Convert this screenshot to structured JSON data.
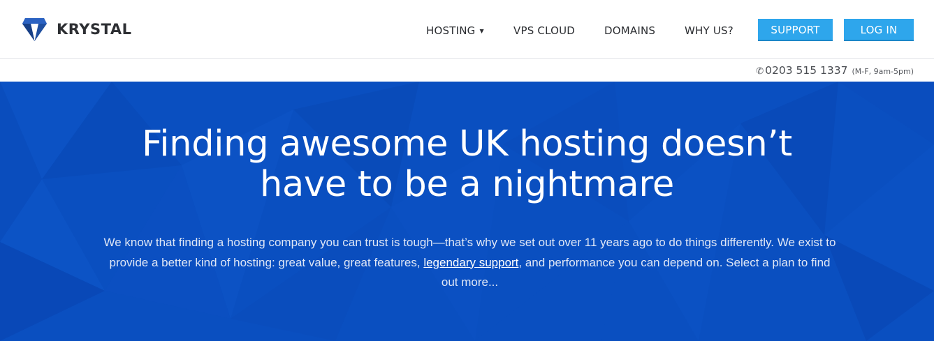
{
  "brand": {
    "name": "KRYSTAL"
  },
  "nav": {
    "items": [
      {
        "label": "HOSTING",
        "has_dropdown": true
      },
      {
        "label": "VPS CLOUD"
      },
      {
        "label": "DOMAINS"
      },
      {
        "label": "WHY US?"
      }
    ],
    "support_label": "SUPPORT",
    "login_label": "LOG IN"
  },
  "contact": {
    "icon": "phone-icon",
    "phone": "0203 515 1337",
    "hours": "(M-F, 9am-5pm)"
  },
  "hero": {
    "title_line1": "Finding awesome UK hosting doesn’t",
    "title_line2": "have to be a nightmare",
    "text_before": "We know that finding a hosting company you can trust is tough—that’s why we set out over 11 years ago to do things differently. We exist to provide a better kind of hosting: great value, great features, ",
    "link_text": "legendary support",
    "text_after": ", and performance you can depend on. Select a plan to find out more..."
  },
  "colors": {
    "accent_button": "#2ea6ec",
    "hero_background": "#0a4fc0",
    "logo_blue": "#1f4fa0",
    "nav_text": "#2b2d31"
  }
}
